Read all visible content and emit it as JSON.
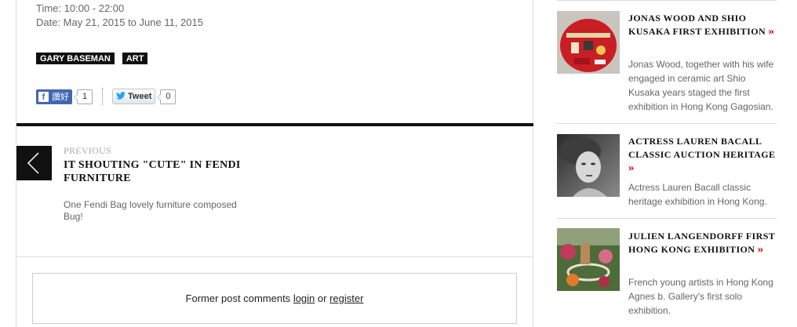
{
  "event": {
    "time": "Time: 10:00 - 22:00",
    "date": "Date: May 21, 2015 to June 11, 2015"
  },
  "tags": [
    "GARY BASEMAN",
    "ART"
  ],
  "share": {
    "facebook_icon": "f",
    "facebook_label": "讚好",
    "facebook_count": "1",
    "tweet_label": "Tweet",
    "tweet_count": "0"
  },
  "previous": {
    "label": "PREVIOUS",
    "title": "IT SHOUTING \"CUTE\" IN FENDI FURNITURE",
    "excerpt": "One Fendi Bag lovely furniture composed Bug!"
  },
  "comments": {
    "prefix": "Former post comments",
    "login": "login",
    "or": "or",
    "register": "register"
  },
  "sidebar": {
    "items": [
      {
        "title": "JONAS WOOD AND SHIO KUSAKA FIRST EXHIBITION",
        "more": "»",
        "excerpt": "Jonas Wood, together with his wife engaged in ceramic art Shio Kusaka years staged the first exhibition in Hong Kong Gagosian."
      },
      {
        "title": "ACTRESS LAUREN BACALL CLASSIC AUCTION HERITAGE",
        "more": "»",
        "excerpt": "Actress Lauren Bacall classic heritage exhibition in Hong Kong."
      },
      {
        "title": "JULIEN LANGENDORFF FIRST HONG KONG EXHIBITION",
        "more": "»",
        "excerpt": "French young artists in Hong Kong Agnes b. Gallery's first solo exhibition."
      }
    ]
  }
}
